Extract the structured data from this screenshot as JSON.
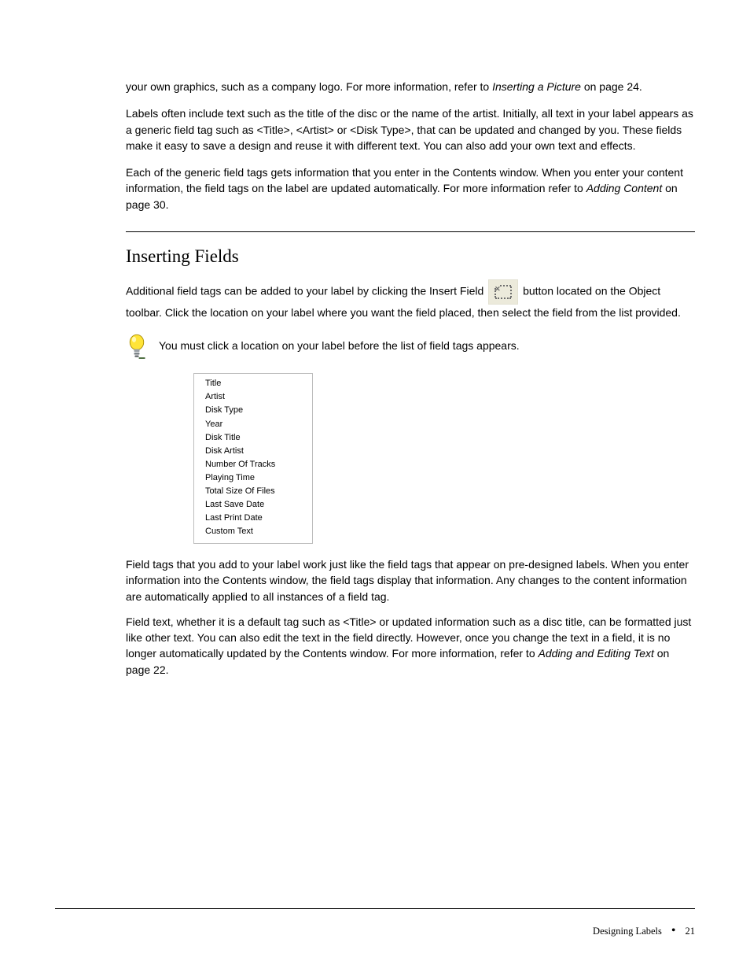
{
  "intro": {
    "p1_a": "your own graphics, such as a company logo. For more information, refer to ",
    "p1_b": " on page 24.",
    "p1_link": "Inserting a Picture",
    "p2": "Labels often include text such as the title of the disc or the name of the artist. Initially, all text in your label appears as a generic field tag such as <Title>, <Artist> or <Disk Type>, that can be updated and changed by you. These fields make it easy to save a design and reuse it with different text. You can also add your own text and effects.",
    "p3_a": "Each of the generic field tags gets information that you enter in the Contents window. When you enter your content information, the field tags on the label are updated automatically. For more information refer to ",
    "p3_b": " on page 30.",
    "p3_link": "Adding Content"
  },
  "section": {
    "title": "Inserting Fields",
    "p1_a": "Additional field tags can be added to your label by clicking the Insert Field ",
    "p1_b": " button located on the Object toolbar. Click the location on your label where you want the field placed, then select the field from the list provided.",
    "tip": "You must click a location on your label before the list of field tags appears."
  },
  "menu": {
    "items": [
      "Title",
      "Artist",
      "Disk Type",
      "Year",
      "Disk Title",
      "Disk Artist",
      "Number Of Tracks",
      "Playing Time",
      "Total Size Of Files",
      "Last Save Date",
      "Last Print Date",
      "Custom Text"
    ]
  },
  "after": {
    "p1": "Field tags that you add to your label work just like the field tags that appear on pre-designed labels. When you enter information into the Contents window, the field tags display that information. Any changes to the content information are automatically applied to all instances of a field tag.",
    "p2_a": "Field text, whether it is a default tag such as <Title> or updated information such as a disc title, can be formatted just like other text. You can also edit the text in the field directly. However, once you change the text in a field, it is no longer automatically updated by the Contents window. For more information, refer to ",
    "p2_b": " on page 22.",
    "p2_link": "Adding and Editing Text"
  },
  "footer": {
    "chapter": "Designing Labels",
    "page": "21"
  }
}
